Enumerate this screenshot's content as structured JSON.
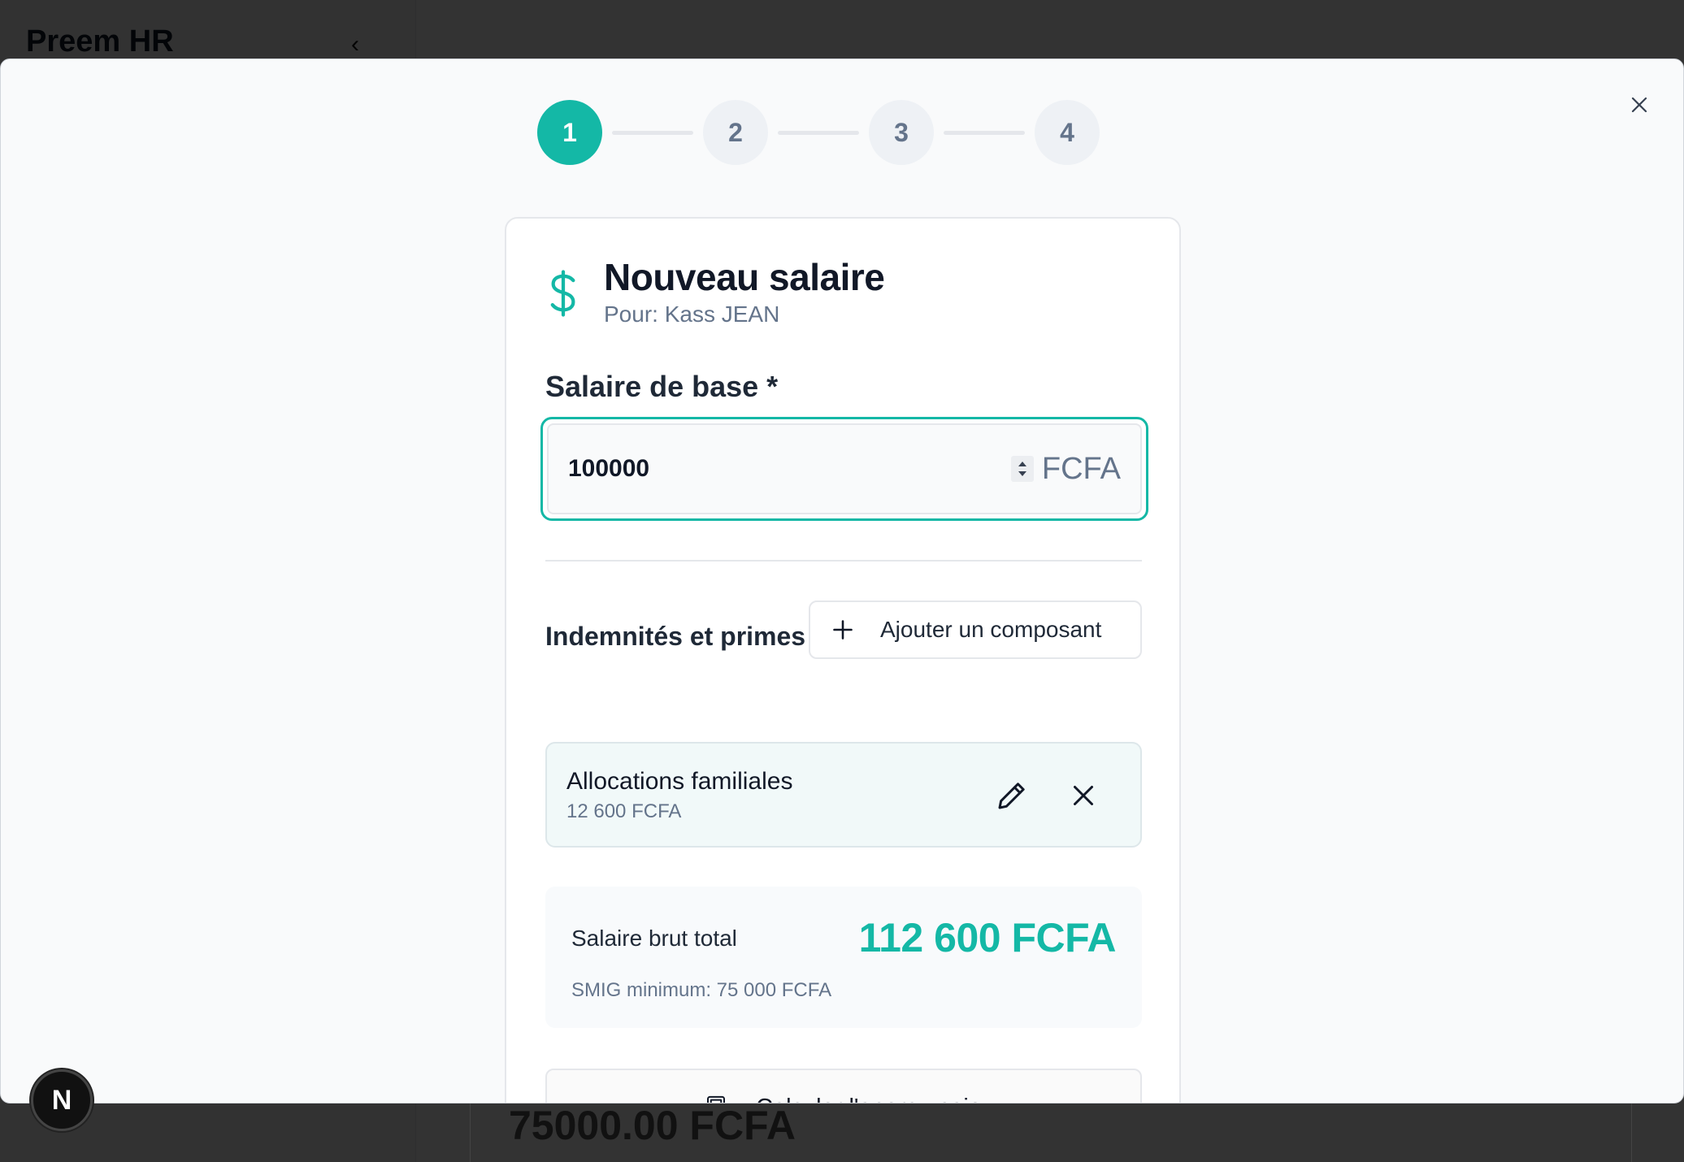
{
  "app": {
    "title": "Preem HR",
    "background_amount": "75000.00 FCFA"
  },
  "stepper": {
    "steps": [
      "1",
      "2",
      "3",
      "4"
    ],
    "active": 1
  },
  "card": {
    "title": "Nouveau salaire",
    "subtitle": "Pour: Kass JEAN",
    "base_salary": {
      "label": "Salaire de base *",
      "value": "100000",
      "suffix": "FCFA"
    },
    "components_section": {
      "label": "Indemnités et primes",
      "add_button": "Ajouter un composant",
      "items": [
        {
          "name": "Allocations familiales",
          "amount": "12 600 FCFA"
        }
      ]
    },
    "total": {
      "label": "Salaire brut total",
      "value": "112 600 FCFA",
      "smig": "SMIG minimum: 75 000 FCFA"
    },
    "calc_button": "Calculer l'aperçu paie"
  },
  "badge": {
    "letter": "N"
  },
  "colors": {
    "accent": "#14b8a6",
    "overlay": "#333333"
  }
}
